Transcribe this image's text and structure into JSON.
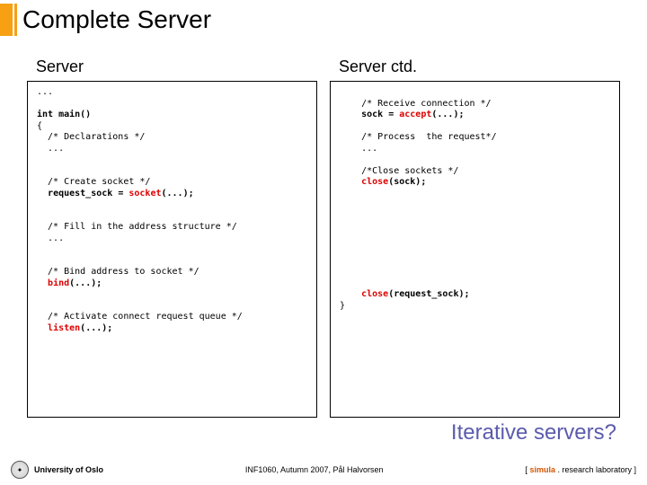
{
  "title": "Complete Server",
  "left": {
    "heading": "Server",
    "intro": "...",
    "main": "int main()",
    "brace_open": "{",
    "decl_c": "  /* Declarations */",
    "decl_e": "  ...",
    "cs_c": "  /* Create socket */",
    "cs_l_pre": "  ",
    "cs_l_var": "request_sock = ",
    "cs_l_fn": "socket",
    "cs_l_tail": "(...);",
    "fill_c": "  /* Fill in the address structure */",
    "fill_e": "  ...",
    "bind_c": "  /* Bind address to socket */",
    "bind_fn": "bind",
    "bind_tail": "(...);",
    "listen_c": "  /* Activate connect request queue */",
    "listen_fn": "listen",
    "listen_tail": "(...);"
  },
  "right": {
    "heading": "Server ctd.",
    "recv_c": "    /* Receive connection */",
    "recv_pre": "    ",
    "recv_var": "sock = ",
    "recv_fn": "accept",
    "recv_tail": "(...);",
    "proc_c": "    /* Process  the request*/",
    "proc_e": "    ...",
    "close_c": "    /*Close sockets */",
    "close_fn": "close",
    "close_tail": "(sock);",
    "closereq_pre": "    ",
    "closereq_fn": "close",
    "closereq_tail": "(request_sock);",
    "brace_close": "}"
  },
  "question": "Iterative servers?",
  "footer": {
    "left_name": "University of Oslo",
    "mid": "INF1060, Autumn 2007, Pål Halvorsen",
    "right_open": "[ ",
    "right_brand": "simula",
    "right_close": " . research laboratory ]"
  }
}
